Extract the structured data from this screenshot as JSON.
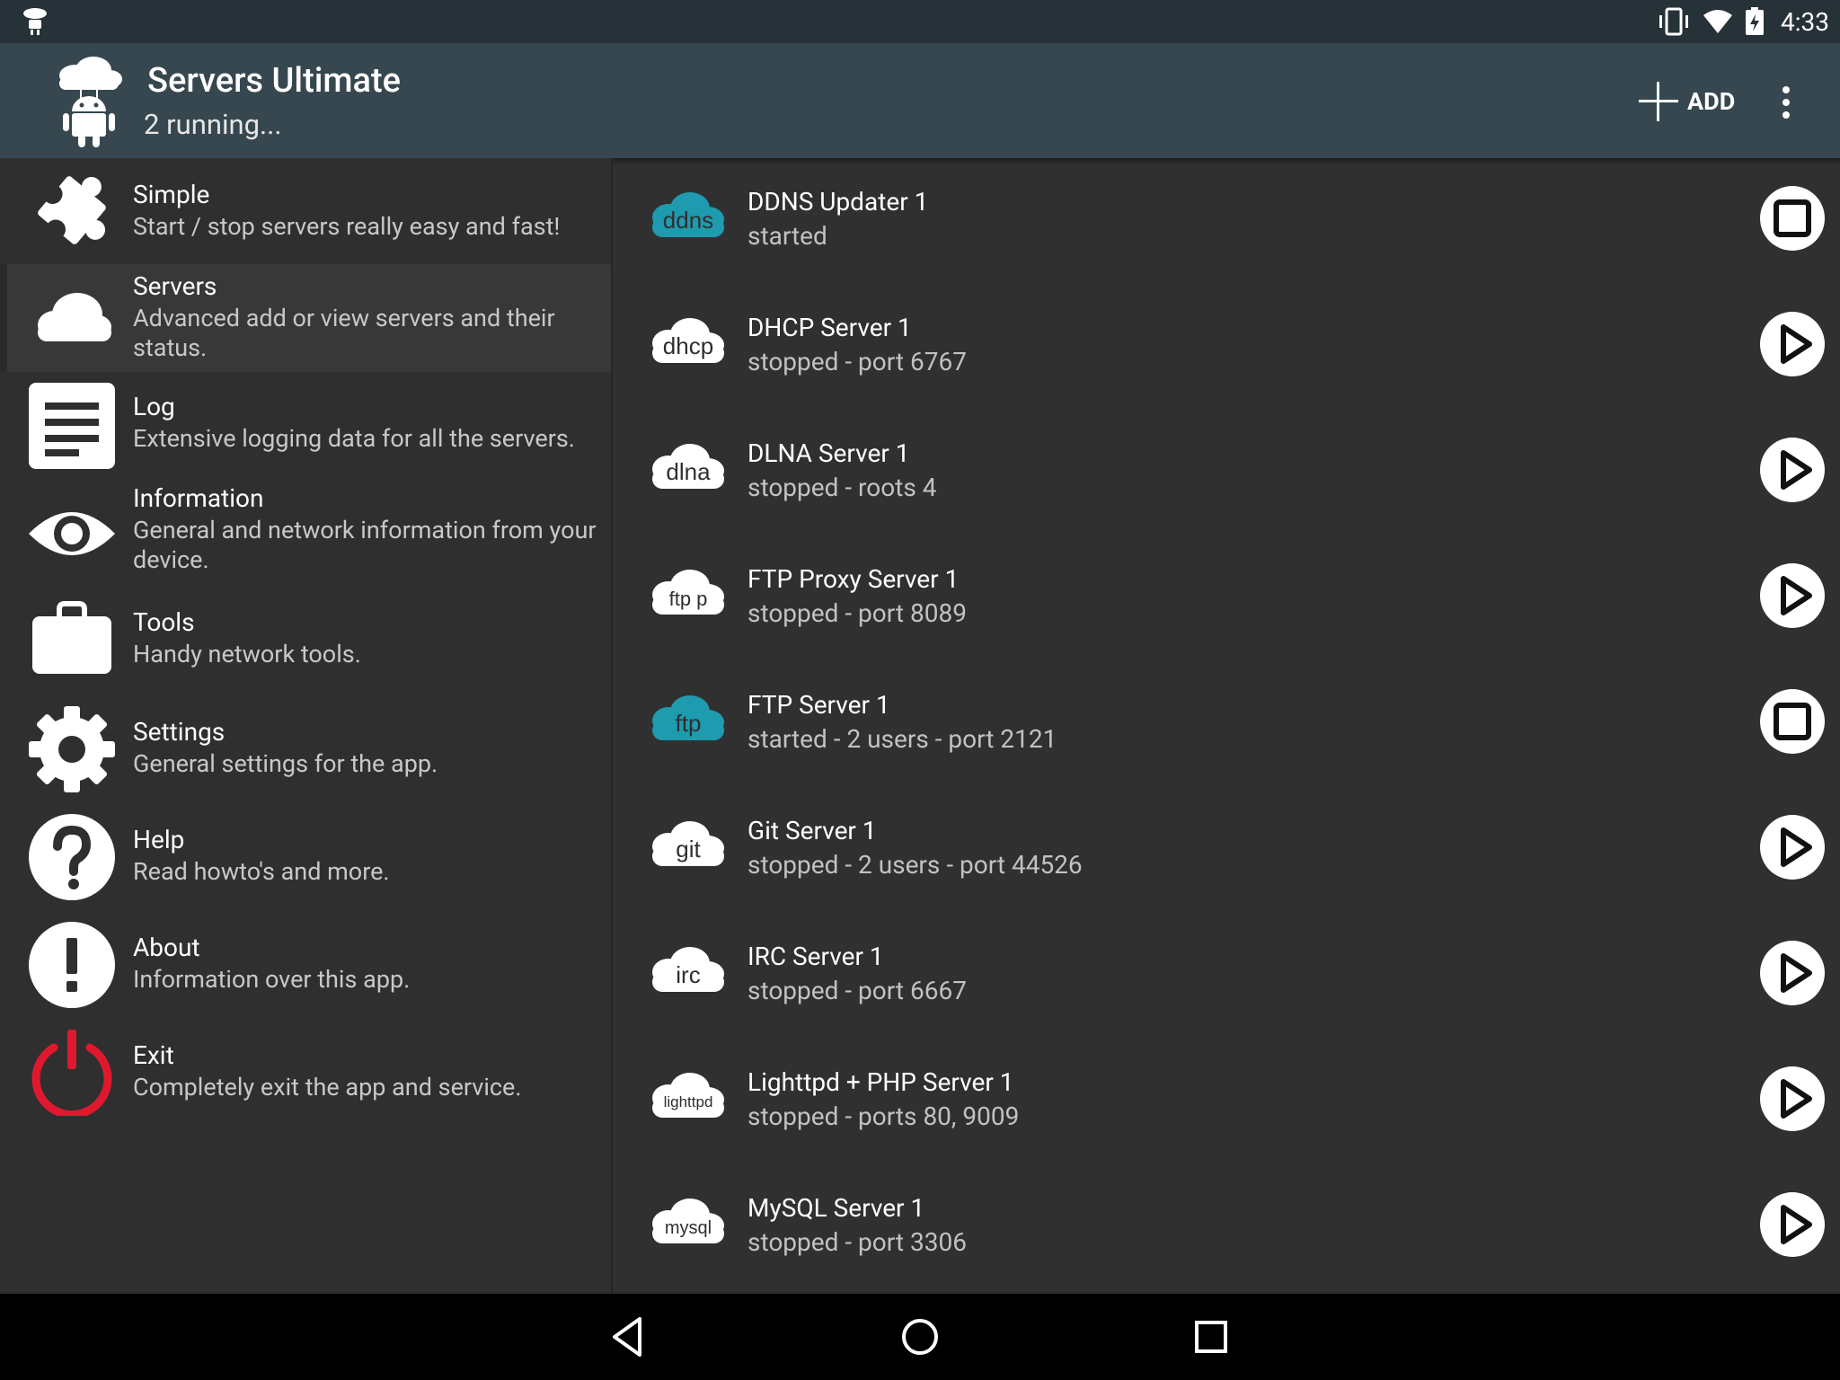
{
  "status_bar": {
    "time": "4:33",
    "icons": [
      "app-notification-icon",
      "vibrate-icon",
      "wifi-icon",
      "battery-icon"
    ]
  },
  "app_bar": {
    "title": "Servers Ultimate",
    "subtitle": "2 running...",
    "add_label": "ADD"
  },
  "menu": [
    {
      "title": "Simple",
      "desc": "Start / stop servers really easy and fast!",
      "icon": "puzzle-icon"
    },
    {
      "title": "Servers",
      "desc": "Advanced add or view servers and their status.",
      "icon": "cloud-icon"
    },
    {
      "title": "Log",
      "desc": "Extensive logging data for all the servers.",
      "icon": "log-icon"
    },
    {
      "title": "Information",
      "desc": "General and network information from your device.",
      "icon": "eye-icon"
    },
    {
      "title": "Tools",
      "desc": "Handy network tools.",
      "icon": "briefcase-icon"
    },
    {
      "title": "Settings",
      "desc": "General settings for the app.",
      "icon": "gear-icon"
    },
    {
      "title": "Help",
      "desc": "Read howto's and more.",
      "icon": "help-icon"
    },
    {
      "title": "About",
      "desc": "Information over this app.",
      "icon": "about-icon"
    },
    {
      "title": "Exit",
      "desc": "Completely exit the app and service.",
      "icon": "power-icon"
    }
  ],
  "servers": [
    {
      "tag": "ddns",
      "name": "DDNS Updater 1",
      "status": "started",
      "running": true
    },
    {
      "tag": "dhcp",
      "name": "DHCP Server 1",
      "status": "stopped - port 6767",
      "running": false
    },
    {
      "tag": "dlna",
      "name": "DLNA Server 1",
      "status": "stopped - roots 4",
      "running": false
    },
    {
      "tag": "ftp p",
      "name": "FTP Proxy Server 1",
      "status": "stopped - port 8089",
      "running": false
    },
    {
      "tag": "ftp",
      "name": "FTP Server 1",
      "status": "started - 2 users - port 2121",
      "running": true
    },
    {
      "tag": "git",
      "name": "Git Server 1",
      "status": "stopped - 2 users - port 44526",
      "running": false
    },
    {
      "tag": "irc",
      "name": "IRC Server 1",
      "status": "stopped - port 6667",
      "running": false
    },
    {
      "tag": "lighttpd",
      "name": "Lighttpd + PHP Server 1",
      "status": "stopped - ports 80, 9009",
      "running": false
    },
    {
      "tag": "mysql",
      "name": "MySQL Server 1",
      "status": "stopped - port 3306",
      "running": false
    }
  ],
  "colors": {
    "status_bar": "#263238",
    "app_bar": "#37474F",
    "background": "#303030",
    "accent_running": "#1E9BAE",
    "exit_red": "#E0182F"
  }
}
